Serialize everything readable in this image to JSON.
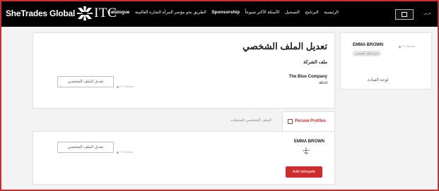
{
  "header": {
    "brand": "SheTrades Global",
    "brand_mark": "ITC",
    "nav": [
      {
        "label": "Catalogue"
      },
      {
        "label": "الطريق نحو مؤتمر المرأة التجارة العالمية"
      },
      {
        "label": "Sponsorship"
      },
      {
        "label": "الأسئلة الأكثر شيوعاً"
      },
      {
        "label": "التسجيل"
      },
      {
        "label": "البرنامج"
      },
      {
        "label": "الرئيسية"
      }
    ],
    "lang": "عربي"
  },
  "profile": {
    "title": "تعديل الملف الشخصي",
    "company_section": "ملف الشركة",
    "company_name": "The Blue Company",
    "company_desc": "abcd",
    "edit_button": "تعديل الملف الشخصي",
    "meta": "ITC Startups"
  },
  "sidebar": {
    "name": "EMMA BROWN",
    "meta": "ITC Startups",
    "badge": "تعديل الملف الشخصي",
    "link": "لوحة القيادة"
  },
  "tabs": {
    "active": "Person Profiles",
    "inactive": "الملف الشخصي للمنتجات"
  },
  "delegate": {
    "name": "EMMA BROWN",
    "edit_button": "تعديل الملف الشخصي",
    "meta": "ITC Startups",
    "add_button": "Add delegate"
  },
  "colors": {
    "accent": "#cf2d2d",
    "header_bg": "#000000"
  }
}
